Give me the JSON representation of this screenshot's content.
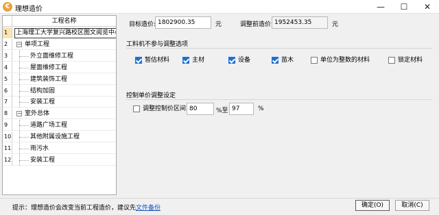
{
  "window": {
    "title": "理想造价",
    "icon": "app-logo-icon",
    "minimize_glyph": "—",
    "maximize_glyph": "☐",
    "close_glyph": "✕"
  },
  "tree": {
    "column_header": "工程名称",
    "rows": [
      {
        "num": "1",
        "label": "上海理工大学复兴路校区图文阅览中心",
        "level": 0,
        "expander": "",
        "selected": true
      },
      {
        "num": "2",
        "label": "单项工程",
        "level": 1,
        "expander": "−",
        "selected": false
      },
      {
        "num": "3",
        "label": "外立面维修工程",
        "level": 2,
        "expander": "",
        "selected": false
      },
      {
        "num": "4",
        "label": "屋面维修工程",
        "level": 2,
        "expander": "",
        "selected": false
      },
      {
        "num": "5",
        "label": "建筑装饰工程",
        "level": 2,
        "expander": "",
        "selected": false
      },
      {
        "num": "6",
        "label": "结构加固",
        "level": 2,
        "expander": "",
        "selected": false
      },
      {
        "num": "7",
        "label": "安装工程",
        "level": 2,
        "expander": "",
        "selected": false
      },
      {
        "num": "8",
        "label": "室外总体",
        "level": 1,
        "expander": "−",
        "selected": false
      },
      {
        "num": "9",
        "label": "道路广场工程",
        "level": 2,
        "expander": "",
        "selected": false
      },
      {
        "num": "10",
        "label": "其他附属设施工程",
        "level": 2,
        "expander": "",
        "selected": false
      },
      {
        "num": "11",
        "label": "雨污水",
        "level": 2,
        "expander": "",
        "selected": false
      },
      {
        "num": "12",
        "label": "安装工程",
        "level": 2,
        "expander": "",
        "selected": false
      }
    ]
  },
  "prices": {
    "target_label": "目标造价:",
    "target_value": "1802900.35",
    "target_unit": "元",
    "before_label": "调整前造价:",
    "before_value": "1952453.35",
    "before_unit": "元"
  },
  "materials": {
    "title": "工料机不参与调整选项",
    "options": [
      {
        "label": "暂估材料",
        "checked": true
      },
      {
        "label": "主材",
        "checked": true
      },
      {
        "label": "设备",
        "checked": true
      },
      {
        "label": "苗木",
        "checked": true
      },
      {
        "label": "单位为整数的材料",
        "checked": false
      },
      {
        "label": "锁定材料",
        "checked": false
      }
    ]
  },
  "control": {
    "title": "控制单价调整设定",
    "checkbox_label": "调整控制价区间:",
    "checked": false,
    "from_value": "80",
    "mid_text": "%至",
    "to_value": "97",
    "end_text": "%"
  },
  "footer": {
    "tip_prefix": "提示：理想造价会改变当前工程造价，建议先",
    "tip_link": "文件备份",
    "ok_label": "确定(O)",
    "cancel_label": "取消(C)"
  },
  "colors": {
    "accent": "#1f6fd0",
    "selected_row": "#fce3b4",
    "link": "#1a4fb8"
  }
}
